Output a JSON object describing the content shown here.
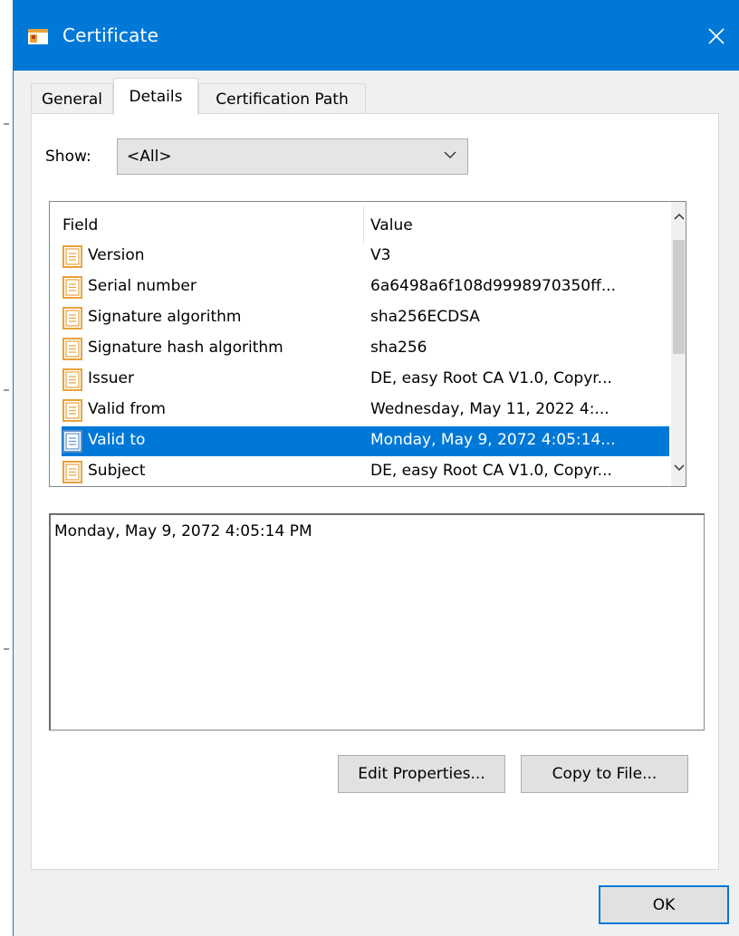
{
  "window": {
    "title": "Certificate",
    "close_glyph": "✕"
  },
  "tabs": [
    {
      "label": "General",
      "active": false
    },
    {
      "label": "Details",
      "active": true
    },
    {
      "label": "Certification Path",
      "active": false
    }
  ],
  "show": {
    "label": "Show:",
    "selected": "<All>"
  },
  "list": {
    "columns": [
      "Field",
      "Value"
    ],
    "rows": [
      {
        "field": "Version",
        "value": "V3"
      },
      {
        "field": "Serial number",
        "value": "6a6498a6f108d9998970350ff..."
      },
      {
        "field": "Signature algorithm",
        "value": "sha256ECDSA"
      },
      {
        "field": "Signature hash algorithm",
        "value": "sha256"
      },
      {
        "field": "Issuer",
        "value": "DE, easy Root CA V1.0, Copyr..."
      },
      {
        "field": "Valid from",
        "value": "Wednesday, May 11, 2022 4:..."
      },
      {
        "field": "Valid to",
        "value": "Monday, May 9, 2072 4:05:14...",
        "selected": true
      },
      {
        "field": "Subject",
        "value": "DE, easy Root CA V1.0, Copyr..."
      }
    ]
  },
  "detail_text": "Monday, May 9, 2072 4:05:14 PM",
  "buttons": {
    "edit_properties": "Edit Properties...",
    "copy_to_file": "Copy to File...",
    "ok": "OK"
  },
  "colors": {
    "titlebar": "#0078d7",
    "selection": "#0078d7",
    "certificate_icon": "#e8a23a"
  }
}
